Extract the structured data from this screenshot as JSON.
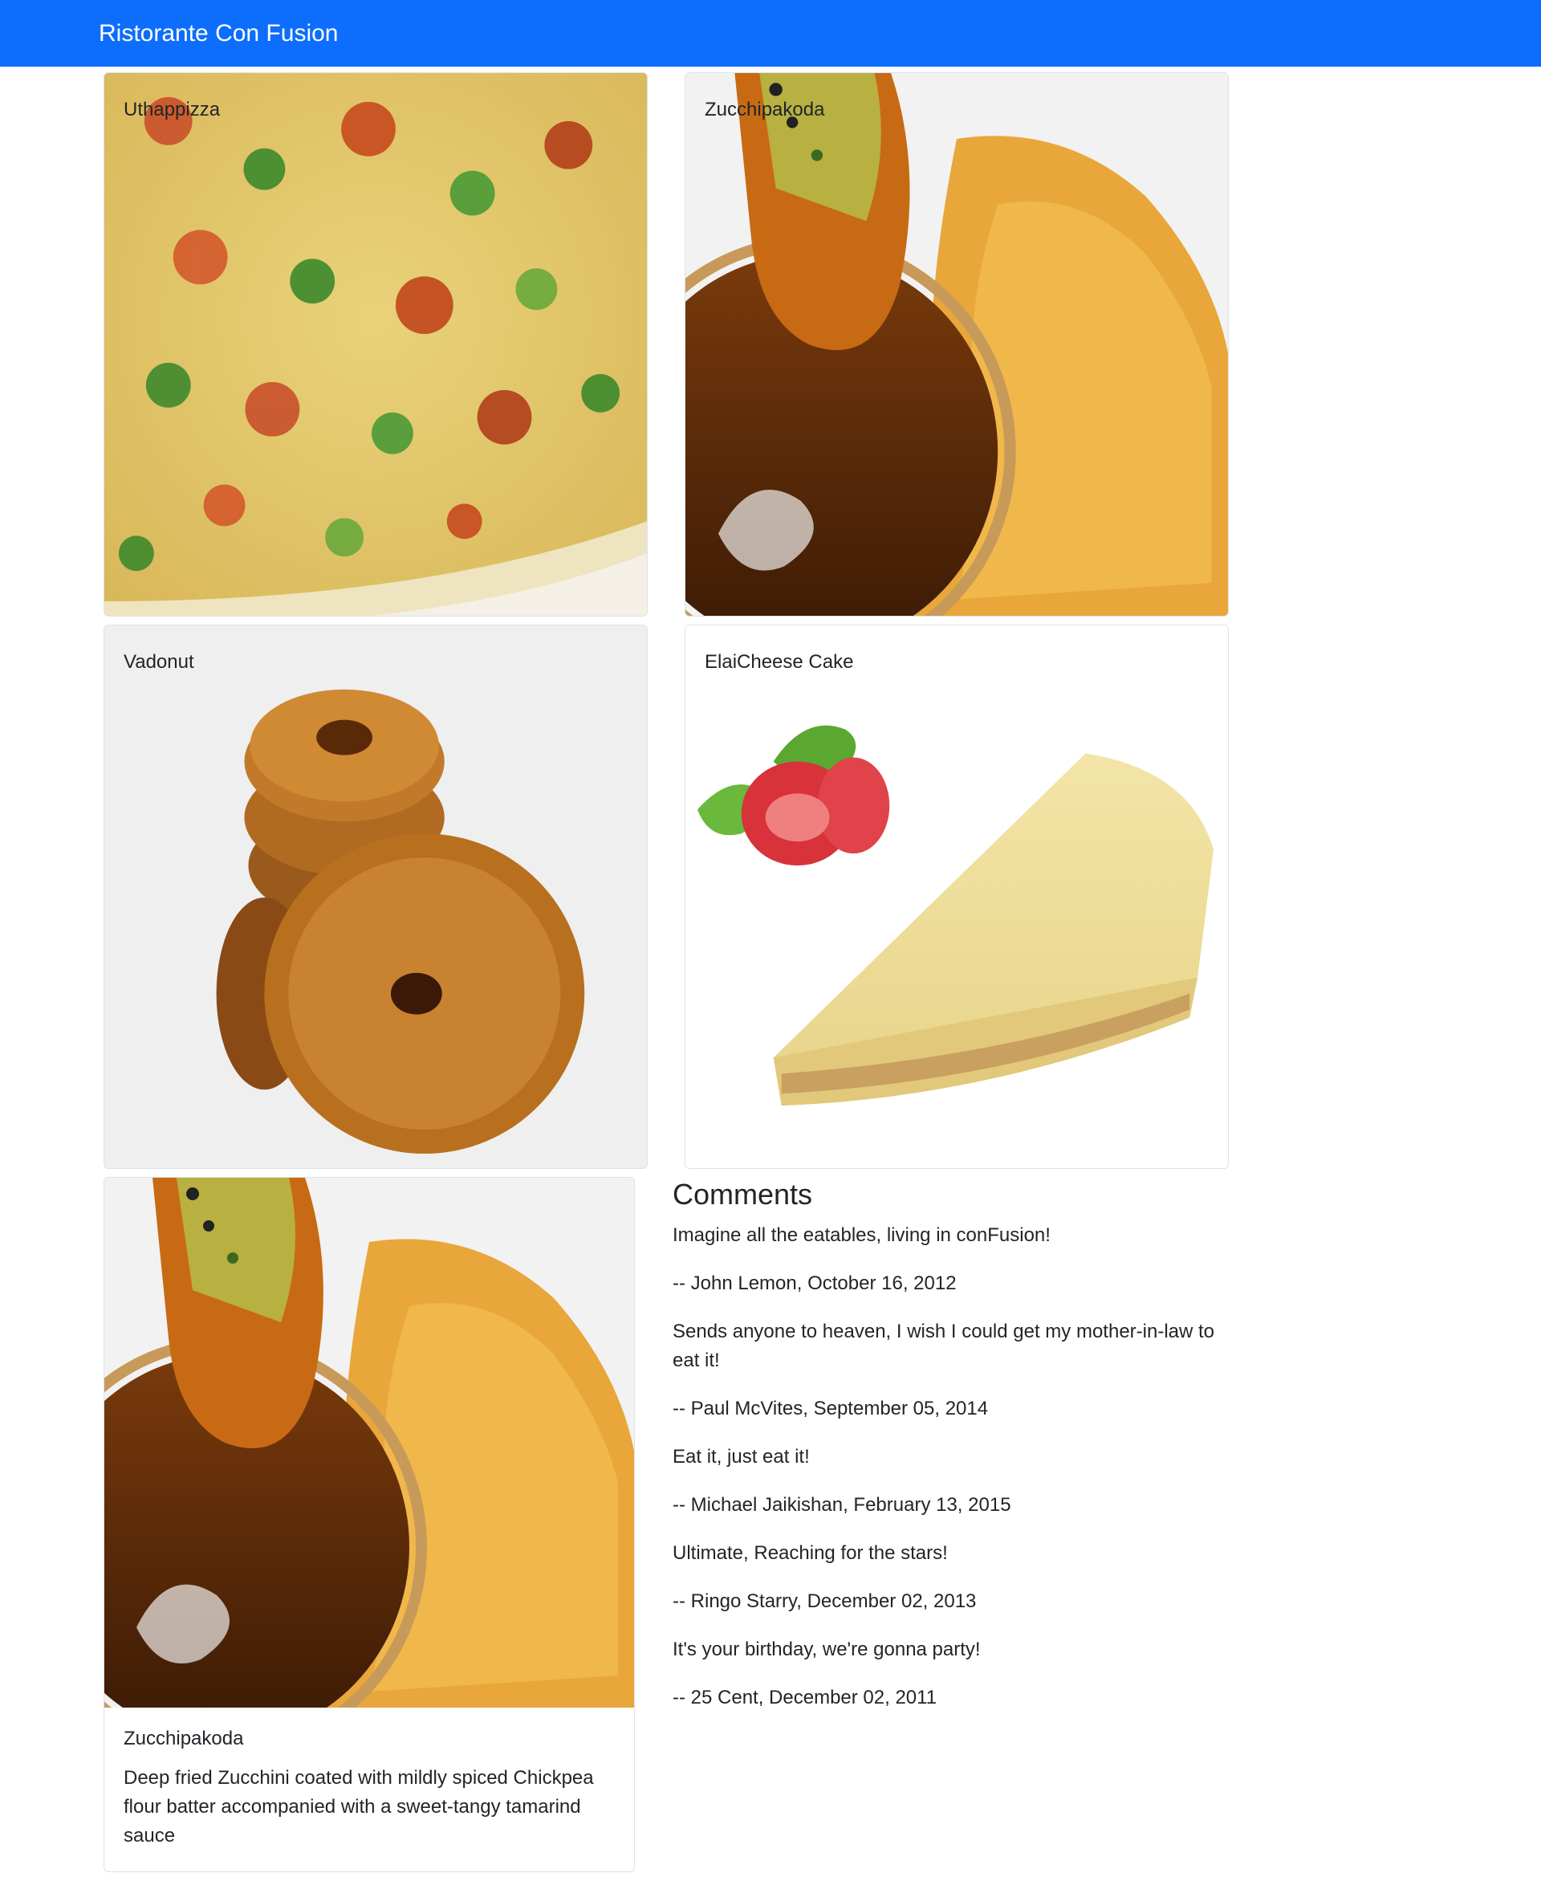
{
  "navbar": {
    "brand": "Ristorante Con Fusion"
  },
  "menu": {
    "items": [
      {
        "name": "Uthappizza",
        "image": "uthappizza-image"
      },
      {
        "name": "Zucchipakoda",
        "image": "zucchipakoda-image"
      },
      {
        "name": "Vadonut",
        "image": "vadonut-image"
      },
      {
        "name": "ElaiCheese Cake",
        "image": "elaicheese-cake-image"
      }
    ]
  },
  "detail": {
    "name": "Zucchipakoda",
    "description": "Deep fried Zucchini coated with mildly spiced Chickpea flour batter accompanied with a sweet-tangy tamarind sauce"
  },
  "comments": {
    "heading": "Comments",
    "list": [
      {
        "text": "Imagine all the eatables, living in conFusion!",
        "byline": "-- John Lemon,  October 16, 2012"
      },
      {
        "text": "Sends anyone to heaven, I wish I could get my mother-in-law to eat it!",
        "byline": "-- Paul McVites,  September 05, 2014"
      },
      {
        "text": "Eat it, just eat it!",
        "byline": "-- Michael Jaikishan,  February 13, 2015"
      },
      {
        "text": "Ultimate, Reaching for the stars!",
        "byline": "-- Ringo Starry,  December 02, 2013"
      },
      {
        "text": "It's your birthday, we're gonna party!",
        "byline": "-- 25 Cent,  December 02, 2011"
      }
    ]
  }
}
